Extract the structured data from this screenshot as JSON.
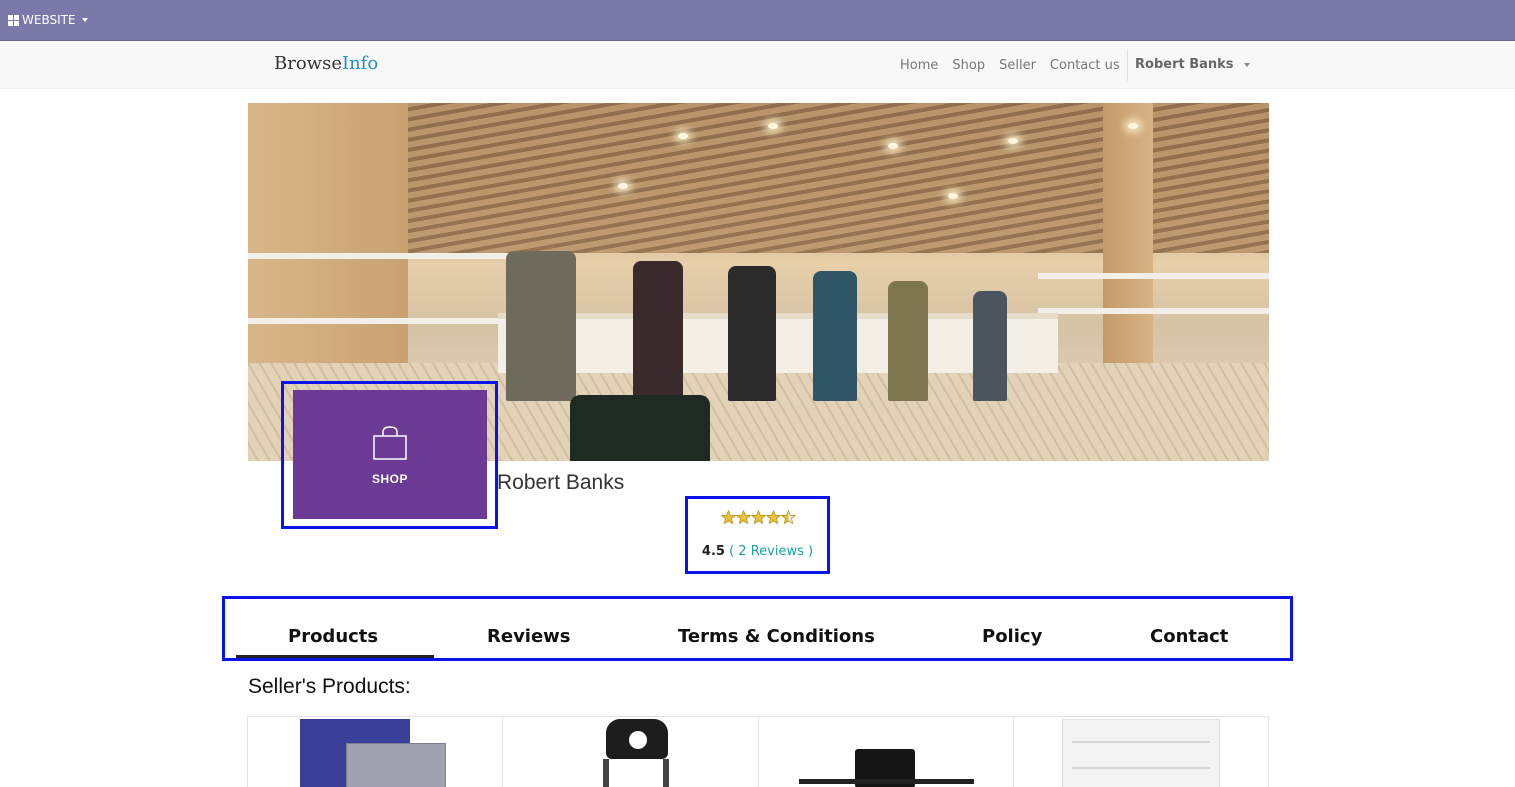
{
  "admin_bar": {
    "apps_label": "WEBSITE"
  },
  "brand": {
    "part1": "Browse",
    "part2": "Info",
    "accent_color": "#1f8fc6"
  },
  "nav": {
    "links": [
      "Home",
      "Shop",
      "Seller",
      "Contact us"
    ],
    "user": "Robert Banks"
  },
  "shop_logo": {
    "label": "SHOP",
    "color": "#6b3a94"
  },
  "seller": {
    "name": "Robert Banks"
  },
  "rating": {
    "stars": 4.5,
    "score": "4.5",
    "reviews": "( 2 Reviews )"
  },
  "tabs": [
    "Products",
    "Reviews",
    "Terms & Conditions",
    "Policy",
    "Contact"
  ],
  "section": {
    "title": "Seller's Products:"
  },
  "highlight_color": "#0b14e8"
}
